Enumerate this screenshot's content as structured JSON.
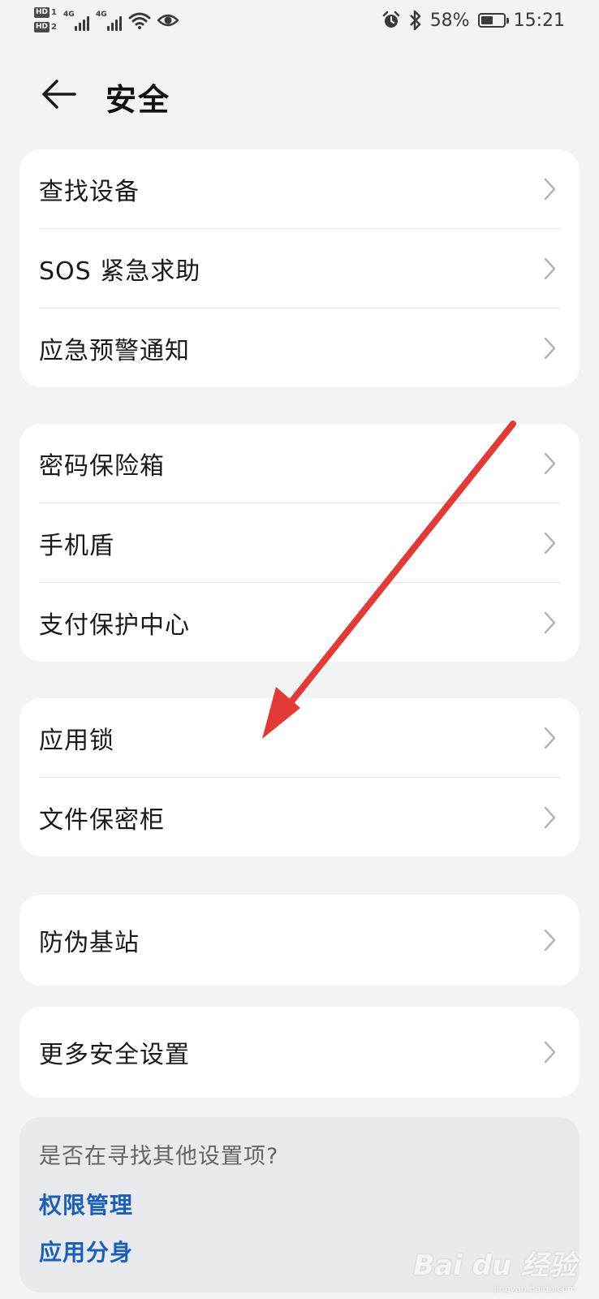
{
  "status_bar": {
    "hd1": "HD",
    "hd1_num": "1",
    "hd2": "HD",
    "hd2_num": "2",
    "net1": "4G",
    "net2": "4G",
    "battery_percent": "58%",
    "battery_level": 0.58,
    "time": "15:21"
  },
  "header": {
    "title": "安全"
  },
  "groups": [
    {
      "items": [
        {
          "label": "查找设备"
        },
        {
          "label": "SOS 紧急求助"
        },
        {
          "label": "应急预警通知"
        }
      ]
    },
    {
      "items": [
        {
          "label": "密码保险箱"
        },
        {
          "label": "手机盾"
        },
        {
          "label": "支付保护中心"
        }
      ]
    },
    {
      "items": [
        {
          "label": "应用锁"
        },
        {
          "label": "文件保密柜"
        }
      ]
    },
    {
      "items": [
        {
          "label": "防伪基站"
        }
      ]
    },
    {
      "items": [
        {
          "label": "更多安全设置"
        }
      ]
    }
  ],
  "suggestions": {
    "question": "是否在寻找其他设置项?",
    "links": [
      {
        "label": "权限管理"
      },
      {
        "label": "应用分身"
      }
    ]
  },
  "annotation": {
    "arrow_color": "#e53935"
  },
  "watermark": {
    "brand": "Bai du 经验",
    "sub": "jingyan.baidu.com"
  }
}
